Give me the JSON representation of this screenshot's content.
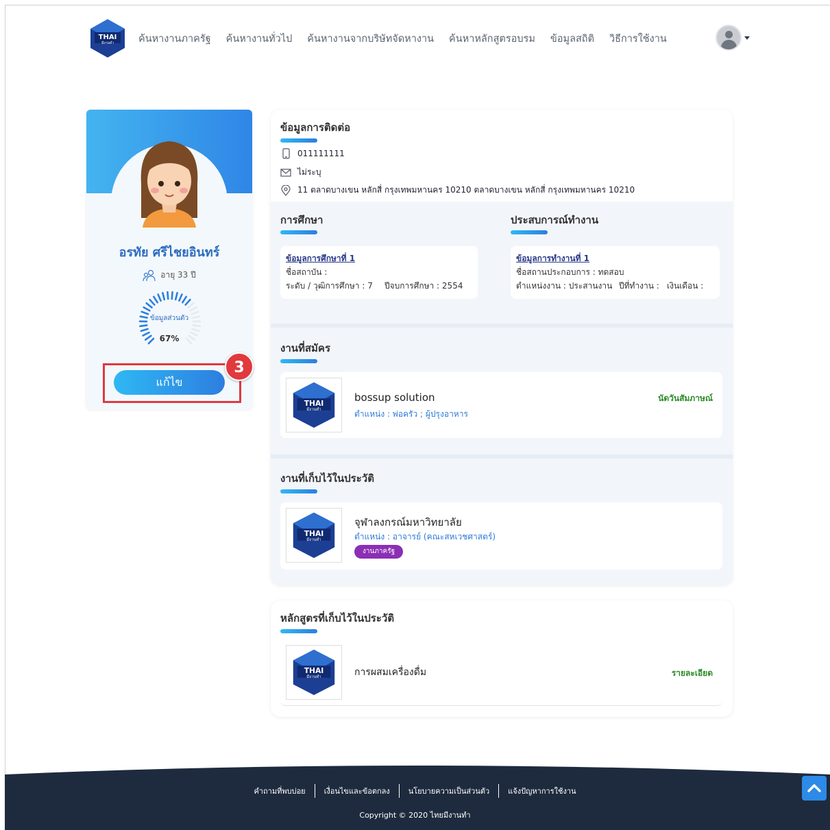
{
  "nav": {
    "logo_text": "THAI",
    "logo_sub": "มีงานทำ",
    "links": [
      "ค้นหางานภาครัฐ",
      "ค้นหางานทั่วไป",
      "ค้นหางานจากบริษัทจัดหางาน",
      "ค้นหาหลักสูตรอบรม",
      "ข้อมูลสถิติ",
      "วิธีการใช้งาน"
    ]
  },
  "profile": {
    "name": "อรทัย ศรีไชยอินทร์",
    "age": "อายุ 33 ปี",
    "completeness_label": "ข้อมูลส่วนตัว",
    "completeness_pct": "67%",
    "completeness_value": 0.67,
    "edit_button": "แก้ไข",
    "step_number": "3"
  },
  "contact": {
    "title": "ข้อมูลการติดต่อ",
    "phone": "011111111",
    "email": "ไม่ระบุ",
    "address": "11 ตลาดบางเขน หลักสี่ กรุงเทพมหานคร 10210 ตลาดบางเขน หลักสี่ กรุงเทพมหานคร 10210"
  },
  "education": {
    "title": "การศึกษา",
    "link": "ข้อมูลการศึกษาที่ 1",
    "institution": "ชื่อสถาบัน :",
    "level": "ระดับ / วุฒิการศึกษา : 7",
    "year": "ปีจบการศึกษา : 2554"
  },
  "experience": {
    "title": "ประสบการณ์ทำงาน",
    "link": "ข้อมูลการทำงานที่ 1",
    "company": "ชื่อสถานประกอบการ : ทดสอบ",
    "position": "ตำแหน่งงาน : ประสานงาน",
    "years": "ปีที่ทำงาน :",
    "salary": "เงินเดือน :"
  },
  "applied": {
    "title": "งานที่สมัคร",
    "company": "bossup solution",
    "position": "ตำแหน่ง : พ่อครัว ; ผู้ปรุงอาหาร",
    "status": "นัดวันสัมภาษณ์"
  },
  "saved_jobs": {
    "title": "งานที่เก็บไว้ในประวัติ",
    "company": "จุฬาลงกรณ์มหาวิทยาลัย",
    "position": "ตำแหน่ง : อาจารย์ (คณะสหเวชศาสตร์)",
    "tag": "งานภาครัฐ"
  },
  "saved_courses": {
    "title": "หลักสูตรที่เก็บไว้ในประวัติ",
    "course": "การผสมเครื่องดื่ม",
    "detail_link": "รายละเอียด"
  },
  "footer": {
    "links": [
      "คำถามที่พบบ่อย",
      "เงื่อนไขและข้อตกลง",
      "นโยบายความเป็นส่วนตัว",
      "แจ้งปัญหาการใช้งาน"
    ],
    "copyright": "Copyright © 2020 ไทยมีงานทำ"
  },
  "colors": {
    "accent": "#2d7ee0",
    "accent_light": "#2fb8f4",
    "highlight": "#e0393e",
    "footer_bg": "#1e2b3e",
    "status_green": "#2d8a28",
    "tag_purple": "#8b2fb5"
  }
}
